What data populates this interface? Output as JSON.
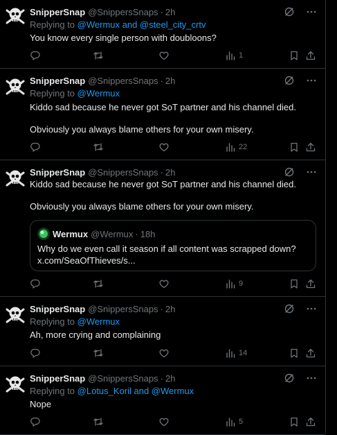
{
  "tweets": [
    {
      "name": "SnipperSnap",
      "handle": "@SnippersSnaps",
      "dot": "·",
      "time": "2h",
      "reply_prefix": "Replying to ",
      "reply_links": "@Wermux and @steel_city_crtv",
      "lines": [
        "You know every single person with doubloons?"
      ],
      "views": "1"
    },
    {
      "name": "SnipperSnap",
      "handle": "@SnippersSnaps",
      "dot": "·",
      "time": "2h",
      "reply_prefix": "Replying to ",
      "reply_links": "@Wermux",
      "lines": [
        "Kiddo sad because he never got SoT partner and his channel died.",
        "Obviously you always blame others for your own misery."
      ],
      "views": "22"
    },
    {
      "name": "SnipperSnap",
      "handle": "@SnippersSnaps",
      "dot": "·",
      "time": "2h",
      "lines": [
        "Kiddo sad because he never got SoT partner and his channel died.",
        "Obviously you always blame others for your own misery."
      ],
      "quote": {
        "name": "Wermux",
        "handle": "@Wermux",
        "dot": "·",
        "time": "18h",
        "line1": "Why do we even call it season if all content was scrapped down?",
        "line2": "x.com/SeaOfThieves/s..."
      },
      "views": "9"
    },
    {
      "name": "SnipperSnap",
      "handle": "@SnippersSnaps",
      "dot": "·",
      "time": "2h",
      "reply_prefix": "Replying to ",
      "reply_links": "@Wermux",
      "lines": [
        "Ah, more crying and complaining"
      ],
      "views": "14"
    },
    {
      "name": "SnipperSnap",
      "handle": "@SnippersSnaps",
      "dot": "·",
      "time": "2h",
      "reply_prefix": "Replying to ",
      "reply_links": "@Lotus_Koril and @Wermux",
      "lines": [
        "Nope"
      ],
      "views": "5"
    }
  ],
  "colors": {
    "text": "#e7e9ea",
    "muted": "#71767b",
    "link": "#1d9bf0",
    "border": "#2f3336",
    "background": "#000000"
  },
  "icons": [
    "pirate-skull-avatar",
    "grok-icon",
    "more-icon",
    "reply-icon",
    "retweet-icon",
    "like-icon",
    "views-icon",
    "bookmark-icon",
    "share-icon"
  ]
}
